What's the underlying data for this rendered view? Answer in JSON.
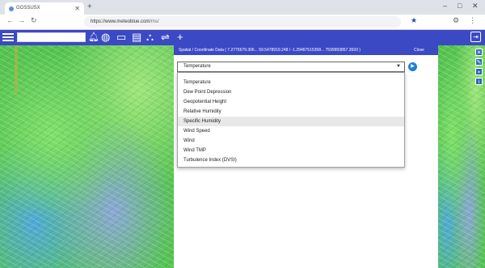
{
  "browser": {
    "tab_title": "GOSSUSX",
    "url_host": "https://www.meteoblue.com",
    "url_path": "/ms/"
  },
  "search": {
    "placeholder": ""
  },
  "panel": {
    "header_text": "Spatial / Coordinate Data ( 7.2775679.306... 59.5478919.248 / -1.29467515358... 7599993857.3593 )",
    "close_label": "Close",
    "selected_value": "Temperature",
    "options": [
      "Temperature",
      "Dew Point Depression",
      "Geopotential Height",
      "Relative Humidity",
      "Specific Humidity",
      "Wind Speed",
      "Wind",
      "Wind TMP",
      "Turbulence Index (DVSI)"
    ],
    "highlighted_index": 4
  },
  "icons": {
    "tab": "globe-favicon",
    "toolbar": [
      "menu-icon",
      "bell-icon",
      "globe-icon",
      "window-icon",
      "document-icon",
      "layers-icon",
      "route-icon",
      "plus-icon",
      "expand-icon"
    ]
  },
  "colors": {
    "app_toolbar": "#3c49c4",
    "highlight": "#e8e8e8",
    "go_button": "#1e7fd6",
    "map_green": "#55c450"
  }
}
